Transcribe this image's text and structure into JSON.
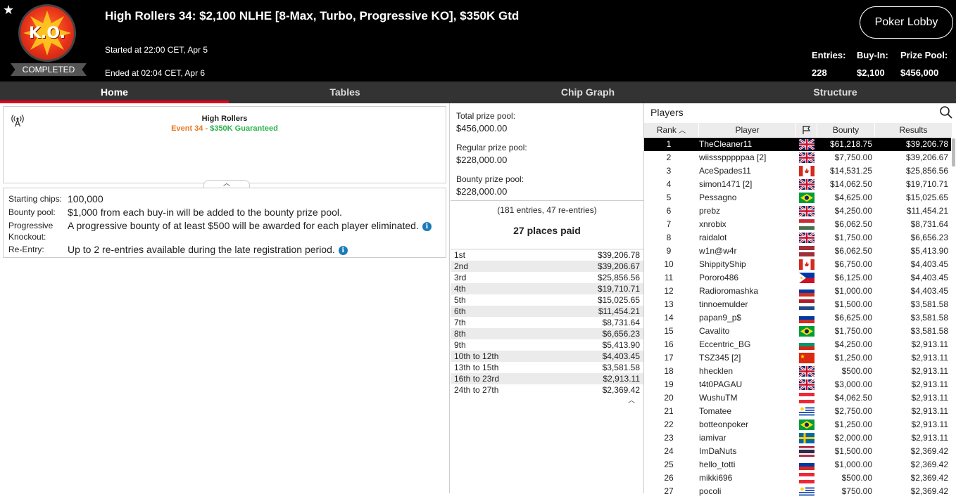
{
  "header": {
    "title": "High Rollers 34: $2,100 NLHE [8-Max, Turbo, Progressive KO], $350K Gtd",
    "logo_text": "K.O.",
    "status_badge": "COMPLETED",
    "started": "Started at 22:00 CET, Apr 5",
    "ended": "Ended at 02:04 CET, Apr 6",
    "lobby_button": "Poker Lobby",
    "entries_label": "Entries:",
    "entries_value": "228",
    "buyin_label": "Buy-In:",
    "buyin_value": "$2,100",
    "prizepool_label": "Prize Pool:",
    "prizepool_value": "$456,000"
  },
  "tabs": [
    "Home",
    "Tables",
    "Chip Graph",
    "Structure"
  ],
  "event": {
    "name": "High Rollers",
    "event_no": "Event 34",
    "separator": " - ",
    "guarantee": "$350K Guaranteed"
  },
  "info": {
    "starting_chips_label": "Starting chips:",
    "starting_chips_value": "100,000",
    "bounty_pool_label": "Bounty pool:",
    "bounty_pool_value": "$1,000 from each buy-in will be added to the bounty prize pool.",
    "progressive_label_1": "Progressive",
    "progressive_label_2": "Knockout:",
    "progressive_value": "A progressive bounty of at least $500 will be awarded for each player eliminated.",
    "reentry_label": "Re-Entry:",
    "reentry_value": "Up to 2 re-entries available during the late registration period."
  },
  "prize_pool": {
    "total_label": "Total prize pool:",
    "total_value": "$456,000.00",
    "regular_label": "Regular prize pool:",
    "regular_value": "$228,000.00",
    "bounty_label": "Bounty prize pool:",
    "bounty_value": "$228,000.00",
    "entries_note": "(181 entries, 47 re-entries)",
    "places_paid": "27 places paid"
  },
  "payouts": [
    {
      "place": "1st",
      "amount": "$39,206.78"
    },
    {
      "place": "2nd",
      "amount": "$39,206.67"
    },
    {
      "place": "3rd",
      "amount": "$25,856.56"
    },
    {
      "place": "4th",
      "amount": "$19,710.71"
    },
    {
      "place": "5th",
      "amount": "$15,025.65"
    },
    {
      "place": "6th",
      "amount": "$11,454.21"
    },
    {
      "place": "7th",
      "amount": "$8,731.64"
    },
    {
      "place": "8th",
      "amount": "$6,656.23"
    },
    {
      "place": "9th",
      "amount": "$5,413.90"
    },
    {
      "place": "10th to 12th",
      "amount": "$4,403.45"
    },
    {
      "place": "13th to 15th",
      "amount": "$3,581.58"
    },
    {
      "place": "16th to 23rd",
      "amount": "$2,913.11"
    },
    {
      "place": "24th to 27th",
      "amount": "$2,369.42"
    }
  ],
  "players_panel": {
    "title": "Players",
    "columns": {
      "rank": "Rank",
      "player": "Player",
      "bounty": "Bounty",
      "results": "Results"
    }
  },
  "players": [
    {
      "rank": "1",
      "name": "TheCleaner11",
      "flag": "gb",
      "bounty": "$61,218.75",
      "result": "$39,206.78"
    },
    {
      "rank": "2",
      "name": "wiissspppppaa [2]",
      "flag": "gb",
      "bounty": "$7,750.00",
      "result": "$39,206.67"
    },
    {
      "rank": "3",
      "name": "AceSpades11",
      "flag": "ca",
      "bounty": "$14,531.25",
      "result": "$25,856.56"
    },
    {
      "rank": "4",
      "name": "simon1471 [2]",
      "flag": "gb",
      "bounty": "$14,062.50",
      "result": "$19,710.71"
    },
    {
      "rank": "5",
      "name": "Pessagno",
      "flag": "br",
      "bounty": "$4,625.00",
      "result": "$15,025.65"
    },
    {
      "rank": "6",
      "name": "prebz",
      "flag": "gb",
      "bounty": "$4,250.00",
      "result": "$11,454.21"
    },
    {
      "rank": "7",
      "name": "xnrobix",
      "flag": "hu",
      "bounty": "$6,062.50",
      "result": "$8,731.64"
    },
    {
      "rank": "8",
      "name": "raidalot",
      "flag": "gb",
      "bounty": "$1,750.00",
      "result": "$6,656.23"
    },
    {
      "rank": "9",
      "name": "w1n@w4r",
      "flag": "lv",
      "bounty": "$6,062.50",
      "result": "$5,413.90"
    },
    {
      "rank": "10",
      "name": "ShippityShip",
      "flag": "ca",
      "bounty": "$6,750.00",
      "result": "$4,403.45"
    },
    {
      "rank": "11",
      "name": "Pororo486",
      "flag": "ph",
      "bounty": "$6,125.00",
      "result": "$4,403.45"
    },
    {
      "rank": "12",
      "name": "Radioromashka",
      "flag": "ru",
      "bounty": "$1,000.00",
      "result": "$4,403.45"
    },
    {
      "rank": "13",
      "name": "tinnoemulder",
      "flag": "nl",
      "bounty": "$1,500.00",
      "result": "$3,581.58"
    },
    {
      "rank": "14",
      "name": "papan9_p$",
      "flag": "ru",
      "bounty": "$6,625.00",
      "result": "$3,581.58"
    },
    {
      "rank": "15",
      "name": "Cavalito",
      "flag": "br",
      "bounty": "$1,750.00",
      "result": "$3,581.58"
    },
    {
      "rank": "16",
      "name": "Eccentric_BG",
      "flag": "bg",
      "bounty": "$4,250.00",
      "result": "$2,913.11"
    },
    {
      "rank": "17",
      "name": "TSZ345 [2]",
      "flag": "cn",
      "bounty": "$1,250.00",
      "result": "$2,913.11"
    },
    {
      "rank": "18",
      "name": "hhecklen",
      "flag": "gb",
      "bounty": "$500.00",
      "result": "$2,913.11"
    },
    {
      "rank": "19",
      "name": "t4t0PAGAU",
      "flag": "gb",
      "bounty": "$3,000.00",
      "result": "$2,913.11"
    },
    {
      "rank": "20",
      "name": "WushuTM",
      "flag": "at",
      "bounty": "$4,062.50",
      "result": "$2,913.11"
    },
    {
      "rank": "21",
      "name": "Tomatee",
      "flag": "uy",
      "bounty": "$2,750.00",
      "result": "$2,913.11"
    },
    {
      "rank": "22",
      "name": "botteonpoker",
      "flag": "br",
      "bounty": "$1,250.00",
      "result": "$2,913.11"
    },
    {
      "rank": "23",
      "name": "iamivar",
      "flag": "se",
      "bounty": "$2,000.00",
      "result": "$2,913.11"
    },
    {
      "rank": "24",
      "name": "ImDaNuts",
      "flag": "th",
      "bounty": "$1,500.00",
      "result": "$2,369.42"
    },
    {
      "rank": "25",
      "name": "hello_totti",
      "flag": "ru",
      "bounty": "$1,000.00",
      "result": "$2,369.42"
    },
    {
      "rank": "26",
      "name": "mikki696",
      "flag": "at",
      "bounty": "$500.00",
      "result": "$2,369.42"
    },
    {
      "rank": "27",
      "name": "pocoli",
      "flag": "uy",
      "bounty": "$750.00",
      "result": "$2,369.42"
    }
  ],
  "colors": {
    "accent_red": "#e3001b",
    "guarantee_green": "#2bb34a",
    "event_orange": "#e87722",
    "info_blue": "#1a7bb9"
  }
}
